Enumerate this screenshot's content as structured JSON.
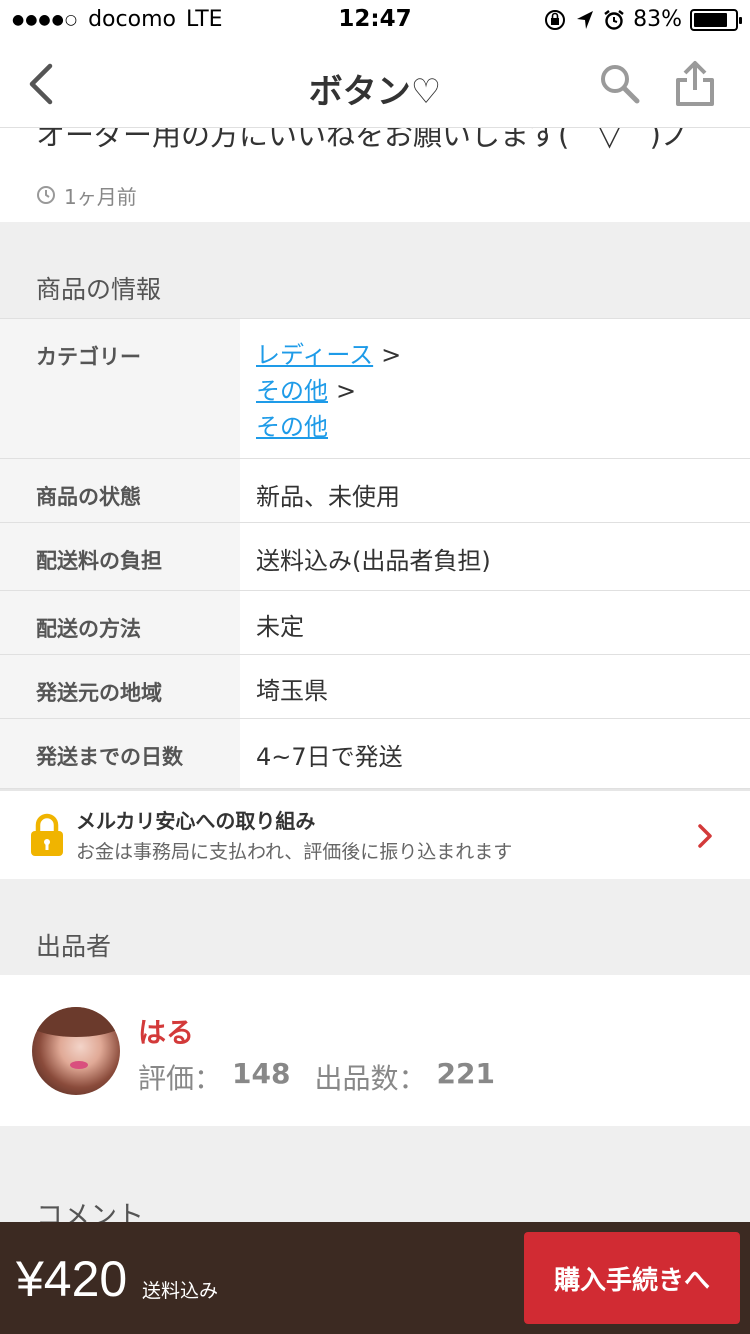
{
  "status_bar": {
    "signal": "●●●●○",
    "carrier": "docomo",
    "network": "LTE",
    "time": "12:47",
    "battery_percent": "83%",
    "battery_level": 0.83
  },
  "nav": {
    "title": "ボタン♡"
  },
  "item": {
    "description_tail": "オーダー用の方にいいねをお願いします(　▽　)ノ",
    "posted_ago": "1ヶ月前"
  },
  "product_info": {
    "header": "商品の情報",
    "category_label": "カテゴリー",
    "categories": [
      "レディース",
      "その他",
      "その他"
    ],
    "category_sep": ">",
    "rows": [
      {
        "label": "商品の状態",
        "value": "新品、未使用"
      },
      {
        "label": "配送料の負担",
        "value": "送料込み(出品者負担)"
      },
      {
        "label": "配送の方法",
        "value": "未定"
      },
      {
        "label": "発送元の地域",
        "value": "埼玉県"
      },
      {
        "label": "発送までの日数",
        "value": "4~7日で発送"
      }
    ]
  },
  "anshin": {
    "title": "メルカリ安心への取り組み",
    "subtitle": "お金は事務局に支払われ、評価後に振り込まれます"
  },
  "seller": {
    "header": "出品者",
    "name": "はる",
    "rating_label": "評価：",
    "rating": "148",
    "listings_label": "出品数：",
    "listings": "221"
  },
  "comments": {
    "header": "コメント"
  },
  "purchase": {
    "price": "¥420",
    "shipping_note": "送料込み",
    "buy_label": "購入手続きへ"
  },
  "colors": {
    "accent_red": "#d12b33",
    "link_blue": "#1e9be8",
    "bottom_bar": "#3c2a22",
    "seller_name": "#d33a3a",
    "lock_yellow": "#f0b400"
  }
}
